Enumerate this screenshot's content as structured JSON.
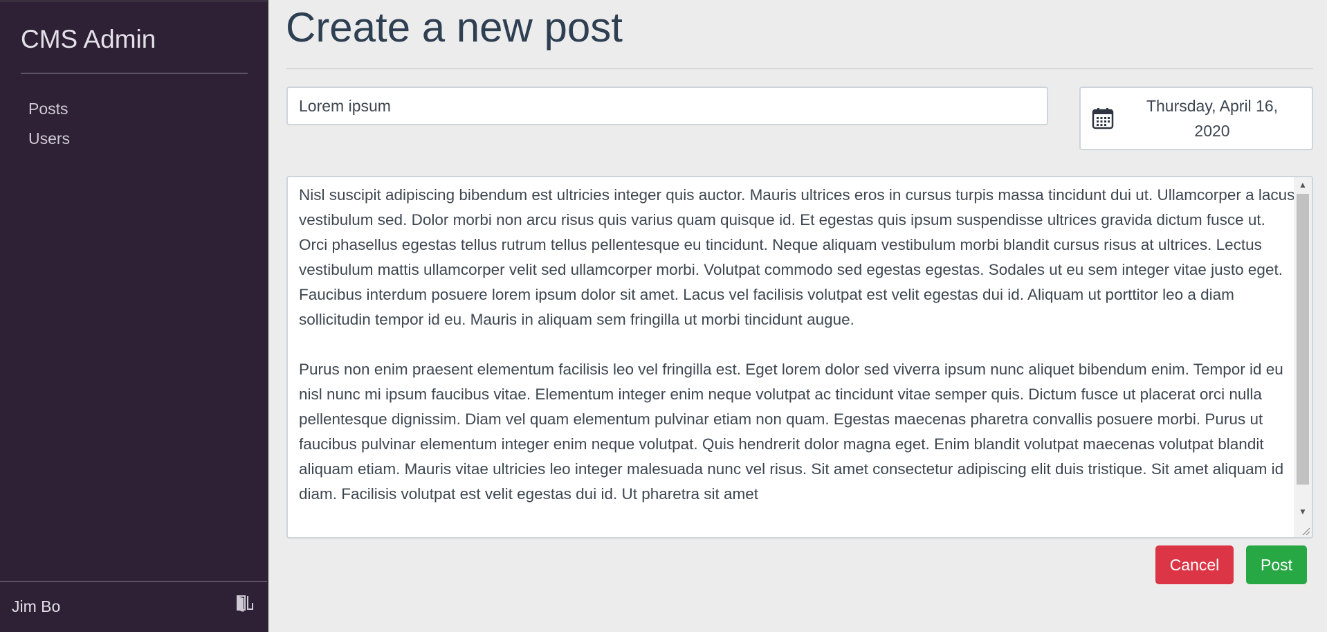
{
  "sidebar": {
    "brand": "CMS Admin",
    "items": [
      {
        "label": "Posts"
      },
      {
        "label": "Users"
      }
    ],
    "footer": {
      "user_name": "Jim Bo",
      "logout_icon": "door-exit-icon"
    }
  },
  "main": {
    "page_title": "Create a new post",
    "title_field": {
      "value": "Lorem ipsum"
    },
    "date_picker": {
      "icon": "calendar-icon",
      "value_line1": "Thursday, April 16,",
      "value_line2": "2020"
    },
    "body_field": {
      "paragraphs": [
        "Nisl suscipit adipiscing bibendum est ultricies integer quis auctor. Mauris ultrices eros in cursus turpis massa tincidunt dui ut. Ullamcorper a lacus vestibulum sed. Dolor morbi non arcu risus quis varius quam quisque id. Et egestas quis ipsum suspendisse ultrices gravida dictum fusce ut. Orci phasellus egestas tellus rutrum tellus pellentesque eu tincidunt. Neque aliquam vestibulum morbi blandit cursus risus at ultrices. Lectus vestibulum mattis ullamcorper velit sed ullamcorper morbi. Volutpat commodo sed egestas egestas. Sodales ut eu sem integer vitae justo eget. Faucibus interdum posuere lorem ipsum dolor sit amet. Lacus vel facilisis volutpat est velit egestas dui id. Aliquam ut porttitor leo a diam sollicitudin tempor id eu. Mauris in aliquam sem fringilla ut morbi tincidunt augue.",
        "Purus non enim praesent elementum facilisis leo vel fringilla est. Eget lorem dolor sed viverra ipsum nunc aliquet bibendum enim. Tempor id eu nisl nunc mi ipsum faucibus vitae. Elementum integer enim neque volutpat ac tincidunt vitae semper quis. Dictum fusce ut placerat orci nulla pellentesque dignissim. Diam vel quam elementum pulvinar etiam non quam. Egestas maecenas pharetra convallis posuere morbi. Purus ut faucibus pulvinar elementum integer enim neque volutpat. Quis hendrerit dolor magna eget. Enim blandit volutpat maecenas volutpat blandit aliquam etiam. Mauris vitae ultricies leo integer malesuada nunc vel risus. Sit amet consectetur adipiscing elit duis tristique. Sit amet aliquam id diam. Facilisis volutpat est velit egestas dui id. Ut pharetra sit amet"
      ]
    },
    "actions": {
      "cancel_label": "Cancel",
      "post_label": "Post"
    }
  },
  "colors": {
    "sidebar_bg": "#2e2136",
    "page_bg": "#ececec",
    "title_color": "#2e3f52",
    "cancel": "#dc3545",
    "post": "#28a745"
  }
}
